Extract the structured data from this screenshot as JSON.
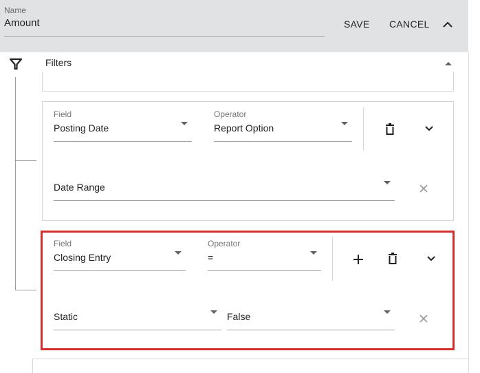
{
  "header": {
    "name_label": "Name",
    "name_value": "Amount",
    "save_label": "SAVE",
    "cancel_label": "CANCEL"
  },
  "filters": {
    "title": "Filters",
    "groups": [
      {
        "field_label": "Field",
        "field_value": "Posting Date",
        "operator_label": "Operator",
        "operator_value": "Report Option",
        "value": "Date Range"
      },
      {
        "field_label": "Field",
        "field_value": "Closing Entry",
        "operator_label": "Operator",
        "operator_value": "=",
        "value_type": "Static",
        "value": "False"
      }
    ]
  },
  "colors": {
    "header_bg": "#e1e2e4",
    "highlight": "#d32f2f"
  }
}
